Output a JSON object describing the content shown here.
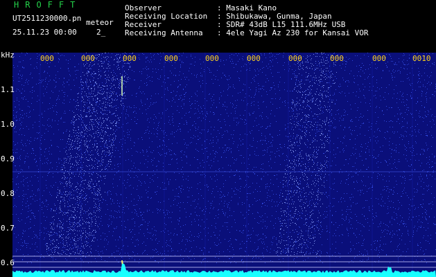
{
  "header": {
    "brand": "HROFFT",
    "file_name": "UT2511230000.pn",
    "mode": "meteor",
    "datetime": "25.11.23 00:00",
    "counter": "2_",
    "info_labels": [
      "Observer",
      "Receiving Location",
      "Receiver",
      "Receiving Antenna"
    ],
    "info_values": [
      ": Masaki Kano",
      ": Shibukawa, Gunma, Japan",
      ": SDR# 43dB L15 111.6MHz USB",
      ": 4ele Yagi Az 230 for Kansai VOR"
    ]
  },
  "axis": {
    "unit": "kHz",
    "y_labels": [
      "1.1",
      "1.0",
      "0.9",
      "0.8",
      "0.7",
      "0.6"
    ],
    "x_labels": [
      "000",
      "000",
      "000",
      "000",
      "000",
      "000",
      "000",
      "000",
      "000",
      "0010"
    ]
  },
  "colors": {
    "background": "#000000",
    "spectrogram_base": "#0a0f7a",
    "noise_dots": "#3f5cff",
    "tick_labels": "#ffd21a",
    "brand": "#24d24a",
    "signal": "#19ffff"
  }
}
